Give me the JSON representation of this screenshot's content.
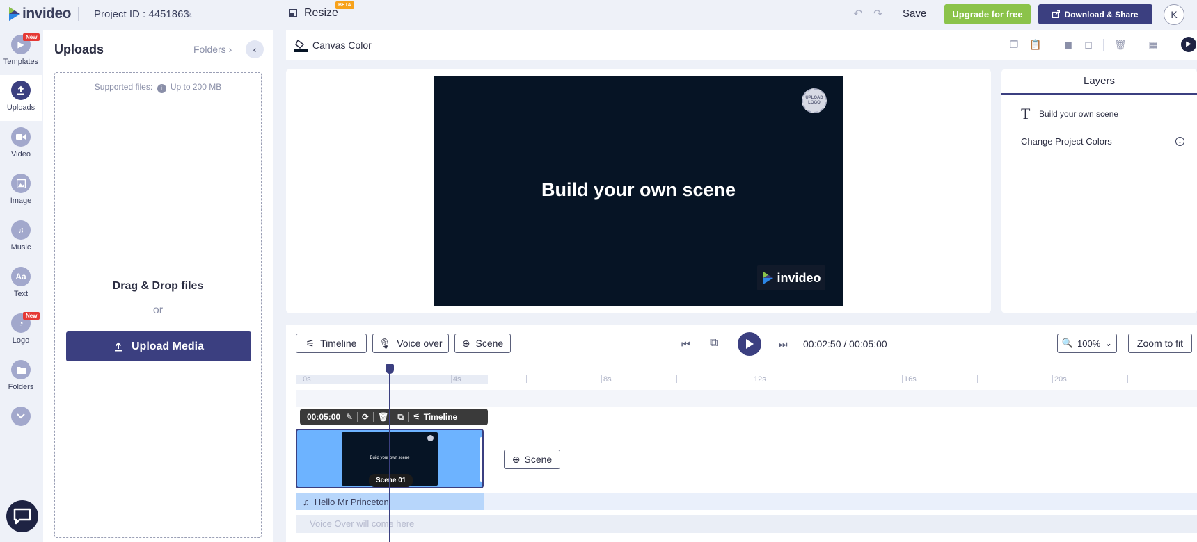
{
  "header": {
    "logo_text": "invideo",
    "project_id": "Project ID : 4451863",
    "resize_label": "Resize",
    "beta_badge": "BETA",
    "save_label": "Save",
    "upgrade_label": "Upgrade for free",
    "download_label": "Download & Share",
    "avatar_initial": "K"
  },
  "rail": {
    "items": [
      {
        "label": "Templates",
        "badge": "New"
      },
      {
        "label": "Uploads"
      },
      {
        "label": "Video"
      },
      {
        "label": "Image"
      },
      {
        "label": "Music"
      },
      {
        "label": "Text",
        "glyph": "Aa"
      },
      {
        "label": "Logo",
        "badge": "New"
      },
      {
        "label": "Folders"
      }
    ]
  },
  "uploads": {
    "title": "Uploads",
    "folders_link": "Folders",
    "supported_label": "Supported files:",
    "size_limit": "Up to 200 MB",
    "drag_title": "Drag & Drop files",
    "or_text": "or",
    "upload_button": "Upload Media"
  },
  "canvas_toolbar": {
    "canvas_color_label": "Canvas Color"
  },
  "preview": {
    "scene_heading": "Build your own scene",
    "upload_logo_text": "UPLOAD LOGO",
    "watermark_text": "invideo"
  },
  "layers": {
    "title": "Layers",
    "items": [
      "Build your own scene"
    ],
    "change_colors": "Change Project Colors"
  },
  "timeline": {
    "timeline_button": "Timeline",
    "voiceover_button": "Voice over",
    "scene_button": "Scene",
    "current_time": "00:02:50",
    "separator": "/",
    "total_time": "00:05:00",
    "zoom_level": "100%",
    "zoom_fit": "Zoom to fit",
    "ruler_labels": [
      "0s",
      "4s",
      "8s",
      "12s",
      "16s",
      "20s"
    ],
    "clip_duration": "00:05:00",
    "clip_timeline_label": "Timeline",
    "thumb_text": "Build your own scene",
    "scene_label": "Scene 01",
    "add_scene_label": "Scene",
    "music_track": "Hello Mr Princeton",
    "voiceover_placeholder": "Voice Over will come here"
  },
  "colors": {
    "primary": "#3b3f80",
    "upgrade": "#8bc34a",
    "scene_bg": "#061425",
    "scene_clip": "#6db3ff",
    "badge_new": "#e53935",
    "badge_beta": "#f7a21b"
  }
}
